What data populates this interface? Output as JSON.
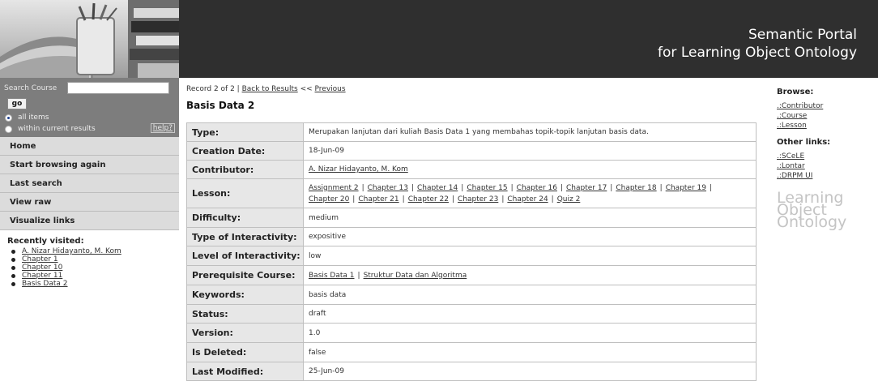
{
  "header": {
    "title_line1": "Semantic Portal",
    "title_line2": "for Learning Object Ontology"
  },
  "search": {
    "label": "Search Course",
    "input_value": "",
    "go_label": "go",
    "option_all": "all items",
    "option_within": "within current results",
    "help_label": "help?"
  },
  "nav": {
    "items": [
      {
        "label": "Home"
      },
      {
        "label": "Start browsing again"
      },
      {
        "label": "Last search"
      },
      {
        "label": "View raw"
      },
      {
        "label": "Visualize links"
      }
    ]
  },
  "recent": {
    "title": "Recently visited:",
    "items": [
      "A. Nizar Hidayanto, M. Kom",
      "Chapter 1",
      "Chapter 10",
      "Chapter 11",
      "Basis Data 2"
    ]
  },
  "record": {
    "position": "Record 2 of 2 |",
    "back_link": "Back to Results",
    "prev_prefix": "<<",
    "prev_link": "Previous",
    "title": "Basis Data 2"
  },
  "details": {
    "type_label": "Type:",
    "type_value": "Merupakan lanjutan dari kuliah Basis Data 1 yang membahas topik-topik lanjutan basis data.",
    "creation_label": "Creation Date:",
    "creation_value": "18-Jun-09",
    "contributor_label": "Contributor:",
    "contributor_value": "A. Nizar Hidayanto, M. Kom",
    "lesson_label": "Lesson:",
    "lessons": [
      "Assignment 2",
      "Chapter 13",
      "Chapter 14",
      "Chapter 15",
      "Chapter 16",
      "Chapter 17",
      "Chapter 18",
      "Chapter 19",
      "Chapter 20",
      "Chapter 21",
      "Chapter 22",
      "Chapter 23",
      "Chapter 24",
      "Quiz 2"
    ],
    "difficulty_label": "Difficulty:",
    "difficulty_value": "medium",
    "interactivity_type_label": "Type of Interactivity:",
    "interactivity_type_value": "expositive",
    "interactivity_level_label": "Level of Interactivity:",
    "interactivity_level_value": "low",
    "prereq_label": "Prerequisite Course:",
    "prereqs": [
      "Basis Data 1",
      "Struktur Data dan Algoritma"
    ],
    "keywords_label": "Keywords:",
    "keywords_value": "basis data",
    "status_label": "Status:",
    "status_value": "draft",
    "version_label": "Version:",
    "version_value": "1.0",
    "deleted_label": "Is Deleted:",
    "deleted_value": "false",
    "modified_label": "Last Modified:",
    "modified_value": "25-Jun-09"
  },
  "browse": {
    "title": "Browse:",
    "links": [
      ".:Contributor",
      ".:Course",
      ".:Lesson"
    ]
  },
  "other": {
    "title": "Other links:",
    "links": [
      ".:SCeLE",
      ".:Lontar",
      ".:DRPM UI"
    ]
  },
  "logo": {
    "line1": "Learning",
    "line2": "Object",
    "line3": "Ontology"
  }
}
